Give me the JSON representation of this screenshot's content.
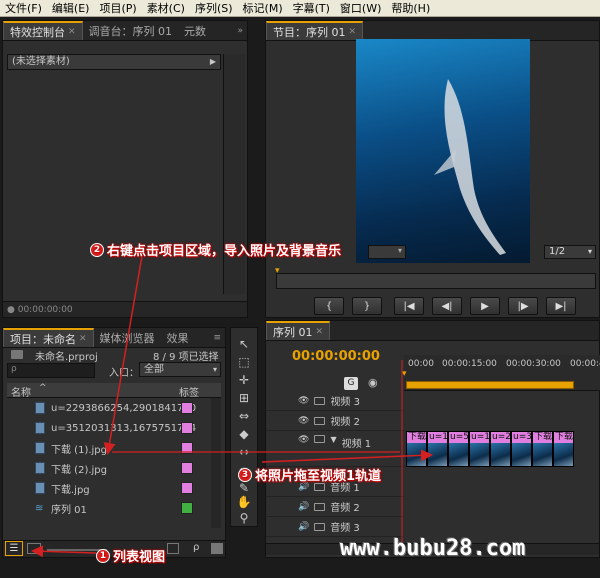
{
  "menu": [
    "文件(F)",
    "编辑(E)",
    "项目(P)",
    "素材(C)",
    "序列(S)",
    "标记(M)",
    "字幕(T)",
    "窗口(W)",
    "帮助(H)"
  ],
  "effect_controls": {
    "tabs": [
      "特效控制台",
      "调音台：序列 01",
      "元数"
    ],
    "no_clip_label": "(未选择素材)",
    "timecode": "00:00:00:00"
  },
  "program": {
    "tab": "节目：序列 01",
    "zoom_select": "1/2"
  },
  "project": {
    "tabs": [
      "项目：未命名",
      "媒体浏览器",
      "效果"
    ],
    "file_name": "未命名.prproj",
    "selection_count": "8 / 9 项已选择",
    "search_placeholder": "ρ",
    "entry_label": "入口：",
    "entry_value": "全部",
    "columns": {
      "name": "名称",
      "label": "标签"
    },
    "items": [
      {
        "name": "u=2293866254,2901841750",
        "color": "#e07fe0"
      },
      {
        "name": "u=3512031313,1675751734",
        "color": "#e07fe0"
      },
      {
        "name": "下载 (1).jpg",
        "color": "#e07fe0"
      },
      {
        "name": "下载 (2).jpg",
        "color": "#e07fe0"
      },
      {
        "name": "下载.jpg",
        "color": "#e07fe0"
      },
      {
        "name": "序列 01",
        "color": "#40b040"
      }
    ]
  },
  "sequence": {
    "tab": "序列 01",
    "timecode": "00:00:00:00",
    "ruler": [
      "00:00",
      "00:00:15:00",
      "00:00:30:00",
      "00:00:45"
    ],
    "video_tracks": [
      "视频 3",
      "视频 2",
      "视频 1"
    ],
    "audio_tracks": [
      "音频 1",
      "音频 2",
      "音频 3"
    ],
    "clips": [
      "下载",
      "u=1",
      "u=5",
      "u=1",
      "u=2",
      "u=3",
      "下载",
      "下载"
    ]
  },
  "annotations": {
    "step1": {
      "num": "1",
      "text": "列表视图"
    },
    "step2": {
      "num": "2",
      "text": "右键点击项目区域，导入照片及背景音乐"
    },
    "step3": {
      "num": "3",
      "text": "将照片拖至视频1轨道"
    }
  },
  "watermark": "www.bubu28.com",
  "colors": {
    "accent": "#e8a200",
    "clip": "#e07fe0",
    "arrow": "#d42020"
  }
}
